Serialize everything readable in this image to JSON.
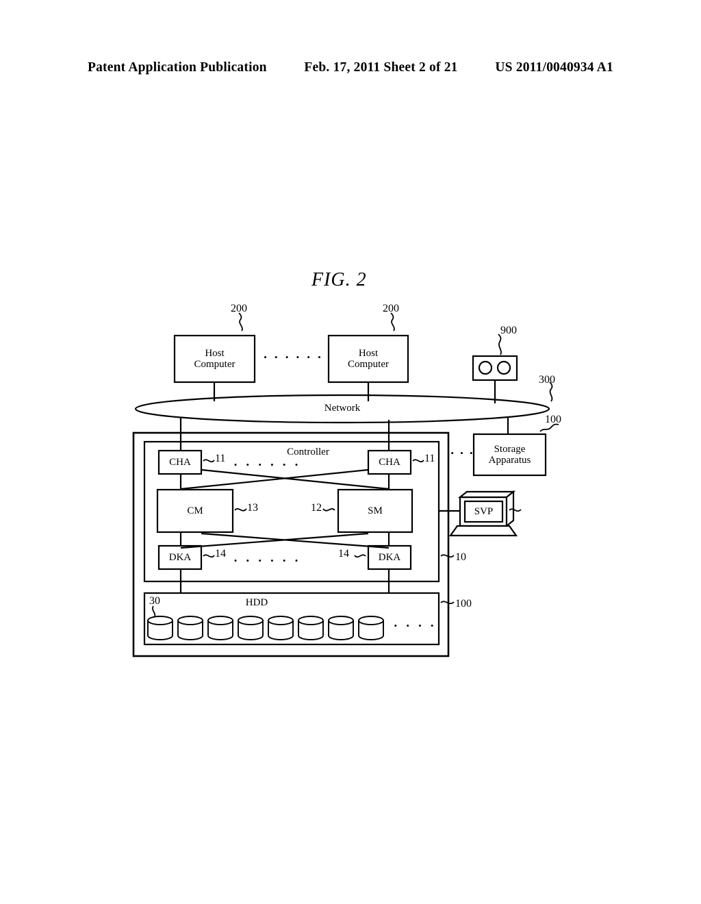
{
  "header": {
    "left": "Patent Application Publication",
    "middle": "Feb. 17, 2011  Sheet 2 of 21",
    "right": "US 2011/0040934 A1"
  },
  "figure": {
    "title": "FIG.  2",
    "nodes": {
      "host_computer_1": "Host\nComputer",
      "host_computer_2": "Host\nComputer",
      "host_computer_label_line1": "Host",
      "host_computer_label_line2": "Computer",
      "network": "Network",
      "controller": "Controller",
      "cha_left": "CHA",
      "cha_right": "CHA",
      "cm": "CM",
      "sm": "SM",
      "dka_left": "DKA",
      "dka_right": "DKA",
      "hdd": "HDD",
      "svp": "SVP",
      "storage_apparatus_line1": "Storage",
      "storage_apparatus_line2": "Apparatus"
    },
    "reference_numerals": {
      "host_computer_1": "200",
      "host_computer_2": "200",
      "tape_device": "900",
      "network": "300",
      "storage_apparatus": "100",
      "cha_left": "11",
      "cha_right": "11",
      "cm": "13",
      "sm": "12",
      "dka_left": "14",
      "dka_right": "14",
      "controller": "10",
      "hdd_unit": "30",
      "hdd_chassis": "100"
    },
    "ellipsis": {
      "between_hosts": "• • • • • •",
      "between_cha": "• • • • • •",
      "between_dka": "• • • • • •",
      "after_controller": "• • •",
      "after_hdd": "• • • •"
    },
    "hdd_count": 8
  },
  "colors": {
    "ink": "#000000",
    "page": "#ffffff"
  }
}
